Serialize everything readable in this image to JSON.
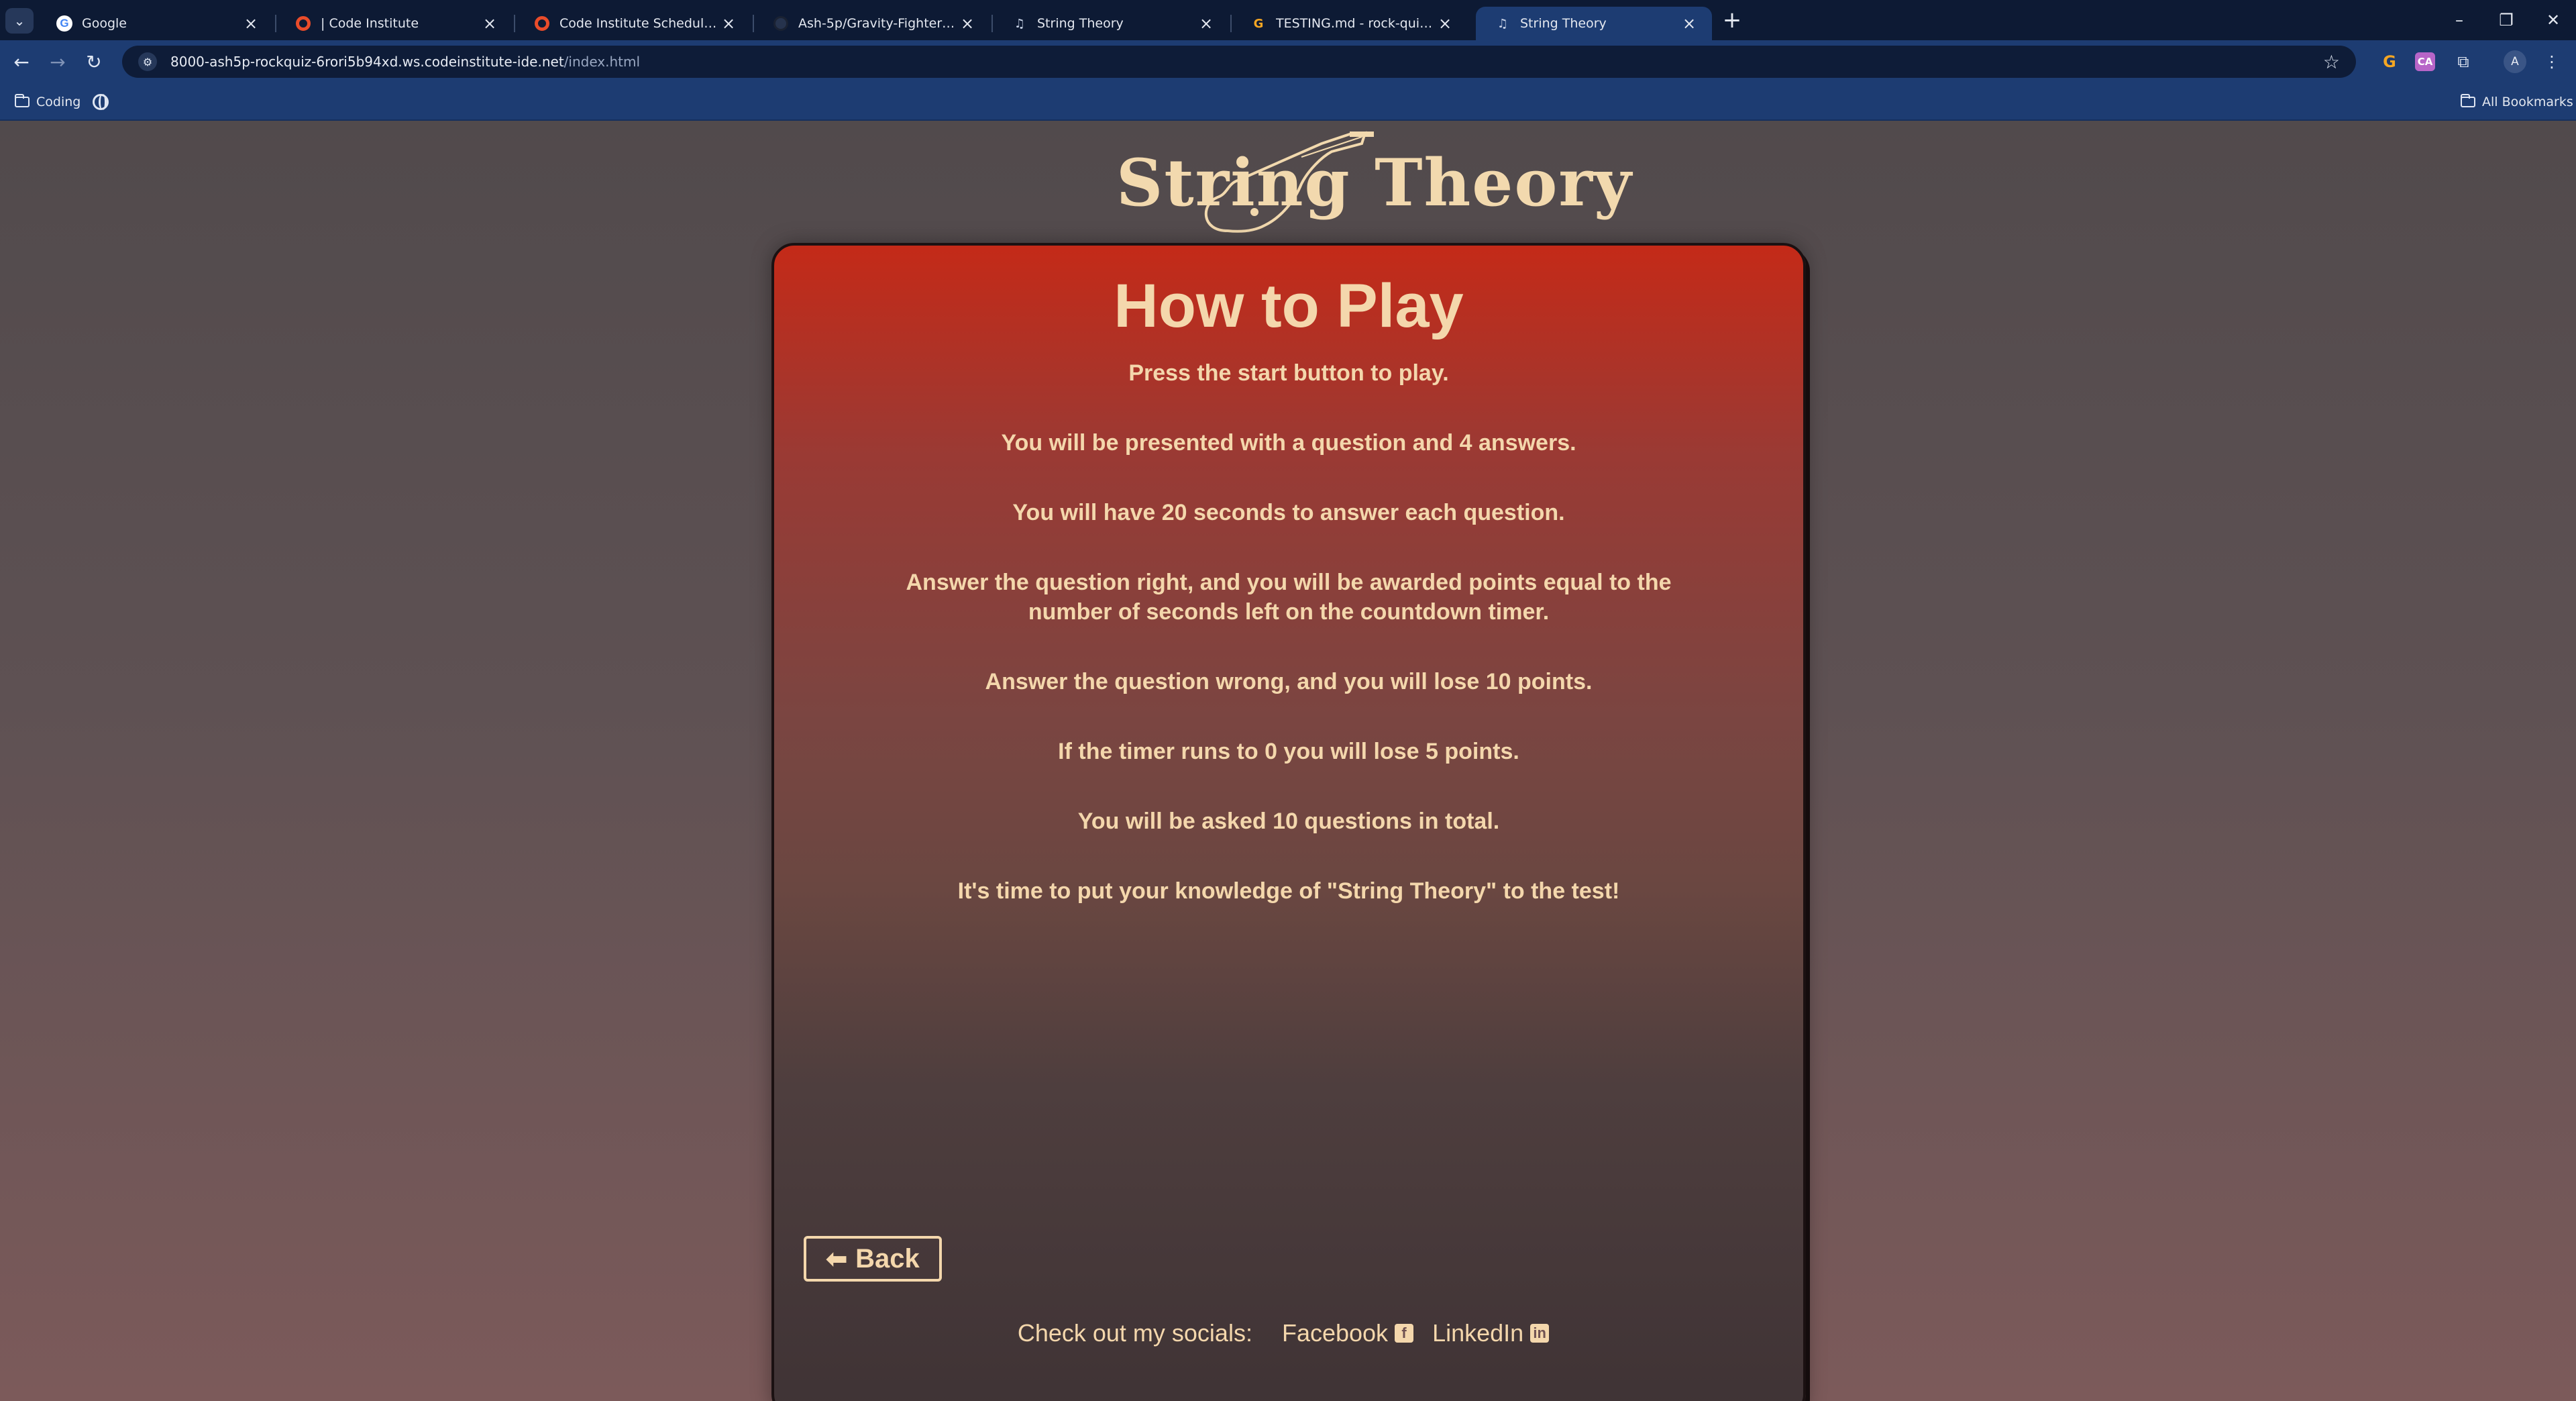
{
  "browser": {
    "tabs": [
      {
        "title": "Google",
        "icon": "google-icon"
      },
      {
        "title": "| Code Institute",
        "icon": "code-institute-icon"
      },
      {
        "title": "Code Institute Schedule Genera",
        "icon": "code-institute-icon"
      },
      {
        "title": "Ash-5p/Gravity-Fighters: Subm",
        "icon": "github-icon"
      },
      {
        "title": "String Theory",
        "icon": "string-theory-icon"
      },
      {
        "title": "TESTING.md - rock-quiz - Gitp",
        "icon": "gitpod-icon"
      },
      {
        "title": "String Theory",
        "icon": "string-theory-icon",
        "active": true
      }
    ],
    "url_host": "8000-ash5p-rockquiz-6rori5b94xd.ws.codeinstitute-ide.net",
    "url_path": "/index.html",
    "avatar_letter": "A",
    "extension_badge": "CA",
    "bookmarks": {
      "folder": "Coding",
      "all": "All Bookmarks"
    }
  },
  "page": {
    "logo_text": "String Theory",
    "title": "How to Play",
    "rules": [
      "Press the start button to play.",
      "You will be presented with a question and 4 answers.",
      "You will have 20 seconds to answer each question.",
      "Answer the question right, and you will be awarded points equal to the number of seconds left on the countdown timer.",
      "Answer the question wrong, and you will lose 10 points.",
      "If the timer runs to 0 you will lose 5 points.",
      "You will be asked 10 questions in total.",
      "It's time to put your knowledge of \"String Theory\" to the test!"
    ],
    "back_label": "Back",
    "footer": {
      "lead": "Check out my socials:",
      "facebook": "Facebook",
      "linkedin": "LinkedIn"
    }
  },
  "colors": {
    "cream": "#f4d7ac",
    "panel_top": "#c42a18",
    "panel_bottom": "#3f3335",
    "chrome_dark": "#0d1a34",
    "chrome_blue": "#1d3c72"
  }
}
